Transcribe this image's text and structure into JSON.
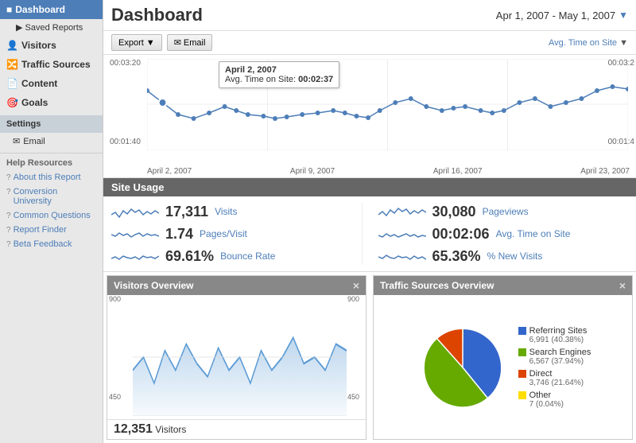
{
  "sidebar": {
    "dashboard_label": "Dashboard",
    "saved_reports_label": "Saved Reports",
    "nav_items": [
      {
        "label": "Visitors",
        "icon": "person-icon"
      },
      {
        "label": "Traffic Sources",
        "icon": "traffic-icon"
      },
      {
        "label": "Content",
        "icon": "content-icon"
      },
      {
        "label": "Goals",
        "icon": "goals-icon"
      }
    ],
    "settings_label": "Settings",
    "settings_items": [
      {
        "label": "Email",
        "icon": "email-icon"
      }
    ],
    "help_header": "Help Resources",
    "help_items": [
      {
        "label": "About this Report"
      },
      {
        "label": "Conversion University"
      },
      {
        "label": "Common Questions"
      },
      {
        "label": "Report Finder"
      },
      {
        "label": "Beta Feedback"
      }
    ]
  },
  "header": {
    "title": "Dashboard",
    "date_range": "Apr 1, 2007 - May 1, 2007",
    "dropdown_arrow": "▼"
  },
  "toolbar": {
    "export_label": "Export",
    "email_label": "Email",
    "avg_time_label": "Avg. Time on Site",
    "dropdown_arrow": "▼"
  },
  "chart": {
    "y_labels": [
      "00:03:20",
      "00:01:40"
    ],
    "x_labels": [
      "April 2, 2007",
      "April 9, 2007",
      "April 16, 2007",
      "April 23, 2007"
    ],
    "tooltip": {
      "date": "April 2, 2007",
      "label": "Avg. Time on Site:",
      "value": "00:02:37"
    },
    "y_right_labels": [
      "00:03:2",
      "00:01:4"
    ]
  },
  "site_usage": {
    "label": "Site Usage",
    "metrics": [
      {
        "value": "17,311",
        "label": "Visits"
      },
      {
        "value": "1.74",
        "label": "Pages/Visit"
      },
      {
        "value": "69.61%",
        "label": "Bounce Rate"
      },
      {
        "value": "30,080",
        "label": "Pageviews"
      },
      {
        "value": "00:02:06",
        "label": "Avg. Time on Site"
      },
      {
        "value": "65.36%",
        "label": "% New Visits"
      }
    ]
  },
  "visitors_panel": {
    "title": "Visitors Overview",
    "close": "×",
    "y_labels": [
      "900",
      "450"
    ],
    "x_labels": [
      "900",
      "450"
    ],
    "footer_value": "12,351",
    "footer_label": "Visitors"
  },
  "traffic_panel": {
    "title": "Traffic Sources Overview",
    "close": "×",
    "legend": [
      {
        "label": "Referring Sites",
        "sub": "6,991 (40.38%)",
        "color": "#3366cc"
      },
      {
        "label": "Search Engines",
        "sub": "6,567 (37.94%)",
        "color": "#66aa00"
      },
      {
        "label": "Direct",
        "sub": "3,746 (21.64%)",
        "color": "#dd4400"
      },
      {
        "label": "Other",
        "sub": "7 (0.04%)",
        "color": "#ffdd00"
      }
    ]
  }
}
